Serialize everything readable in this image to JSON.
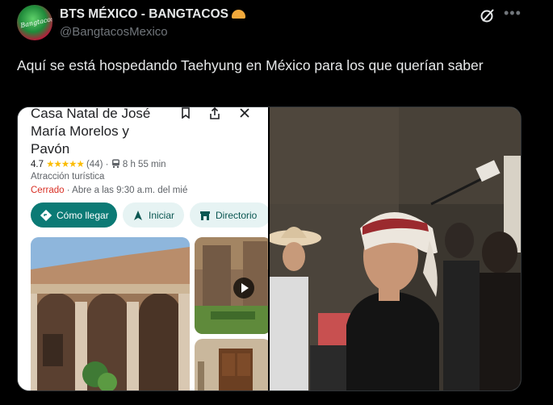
{
  "tweet": {
    "display_name": "BTS MÉXICO - BANGTACOS",
    "handle": "@BangtacosMexico",
    "avatar_text": "Bangtacos",
    "text": "Aquí se está hospedando Taehyung en México para los que querían saber",
    "icons": [
      "taco-emoji",
      "grok-icon",
      "more-icon"
    ]
  },
  "maps_screenshot": {
    "place_name": "Casa Natal de José María Morelos y Pavón",
    "rating": "4.7",
    "stars": "★★★★★",
    "reviews": "(44)",
    "travel_time": "8 h 55 min",
    "category": "Atracción turística",
    "status": "Cerrado",
    "opens": "Abre a las 9:30 a.m. del mié",
    "buttons": {
      "directions": "Cómo llegar",
      "start": "Iniciar",
      "directory": "Directorio"
    },
    "icons": [
      "bookmark-icon",
      "share-icon",
      "close-icon",
      "directions-icon",
      "navigation-icon",
      "directory-icon",
      "play-icon"
    ]
  },
  "colors": {
    "background": "#000000",
    "text": "#e7e9ea",
    "muted": "#71767b",
    "maps_teal": "#0b7a75",
    "closed_red": "#d93025",
    "star_yellow": "#fbbc04"
  }
}
